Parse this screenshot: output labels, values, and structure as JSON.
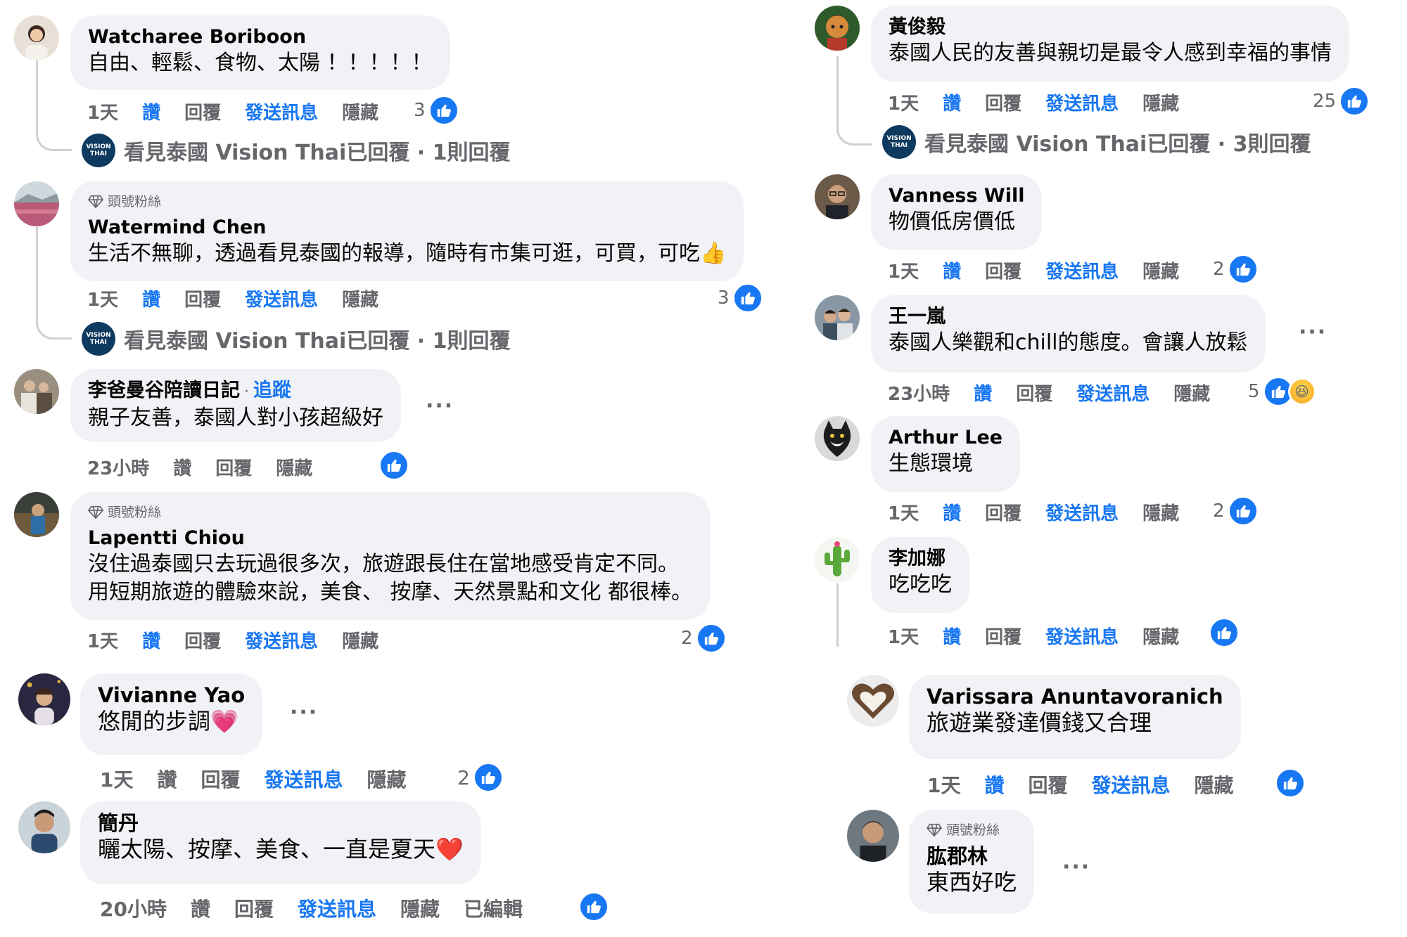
{
  "labels": {
    "like": "讚",
    "reply": "回覆",
    "send_message": "發送訊息",
    "hide": "隱藏",
    "edited": "已編輯",
    "top_fan": "頭號粉絲",
    "follow": "追蹤",
    "more": "···"
  },
  "colors": {
    "accent": "#1877f2",
    "bubble": "#f0f2f5",
    "muted": "#65676b",
    "text": "#050505"
  },
  "left": [
    {
      "author": "Watcharee Boriboon",
      "text": "自由、輕鬆、食物、太陽 ！！！！！",
      "time": "1天",
      "reactions": "3",
      "reply_summary": "看見泰國 Vision Thai已回覆 · 1則回覆"
    },
    {
      "badge": "頭號粉絲",
      "author": "Watermind Chen",
      "text": "生活不無聊，透過看見泰國的報導，隨時有市集可逛，可買，可吃",
      "time": "1天",
      "reactions": "3",
      "reply_summary": "看見泰國 Vision Thai已回覆 · 1則回覆"
    },
    {
      "author": "李爸曼谷陪讀日記",
      "follow": "追蹤",
      "text": "親子友善，泰國人對小孩超級好",
      "time": "23小時",
      "reactions": ""
    },
    {
      "badge": "頭號粉絲",
      "author": "Lapentti Chiou",
      "text_lines": [
        "沒住過泰國只去玩過很多次，旅遊跟長住在當地感受肯定不同。",
        "用短期旅遊的體驗來說，美食、 按摩、天然景點和文化 都很棒。"
      ],
      "time": "1天",
      "reactions": "2"
    },
    {
      "author": "Vivianne Yao",
      "text": "悠閒的步調",
      "time": "1天",
      "reactions": "2"
    },
    {
      "author": "簡丹",
      "text": "曬太陽、按摩、美食、一直是夏天",
      "time": "20小時",
      "reactions": ""
    }
  ],
  "right": [
    {
      "author": "黃俊毅",
      "text": "泰國人民的友善與親切是最令人感到幸福的事情",
      "time": "1天",
      "reactions": "25",
      "reply_summary": "看見泰國 Vision Thai已回覆 · 3則回覆"
    },
    {
      "author": "Vanness Will",
      "text": "物價低房價低",
      "time": "1天",
      "reactions": "2"
    },
    {
      "author": "王一嵐",
      "text": "泰國人樂觀和chill的態度。會讓人放鬆",
      "time": "23小時",
      "reactions": "5"
    },
    {
      "author": "Arthur Lee",
      "text": "生態環境",
      "time": "1天",
      "reactions": "2"
    },
    {
      "author": "李加娜",
      "text": "吃吃吃",
      "time": "1天",
      "reactions": ""
    },
    {
      "author": "Varissara Anuntavoranich",
      "text": "旅遊業發達價錢又合理",
      "time": "1天",
      "reactions": ""
    },
    {
      "badge": "頭號粉絲",
      "author": "肱郡林",
      "text": "東西好吃"
    }
  ]
}
